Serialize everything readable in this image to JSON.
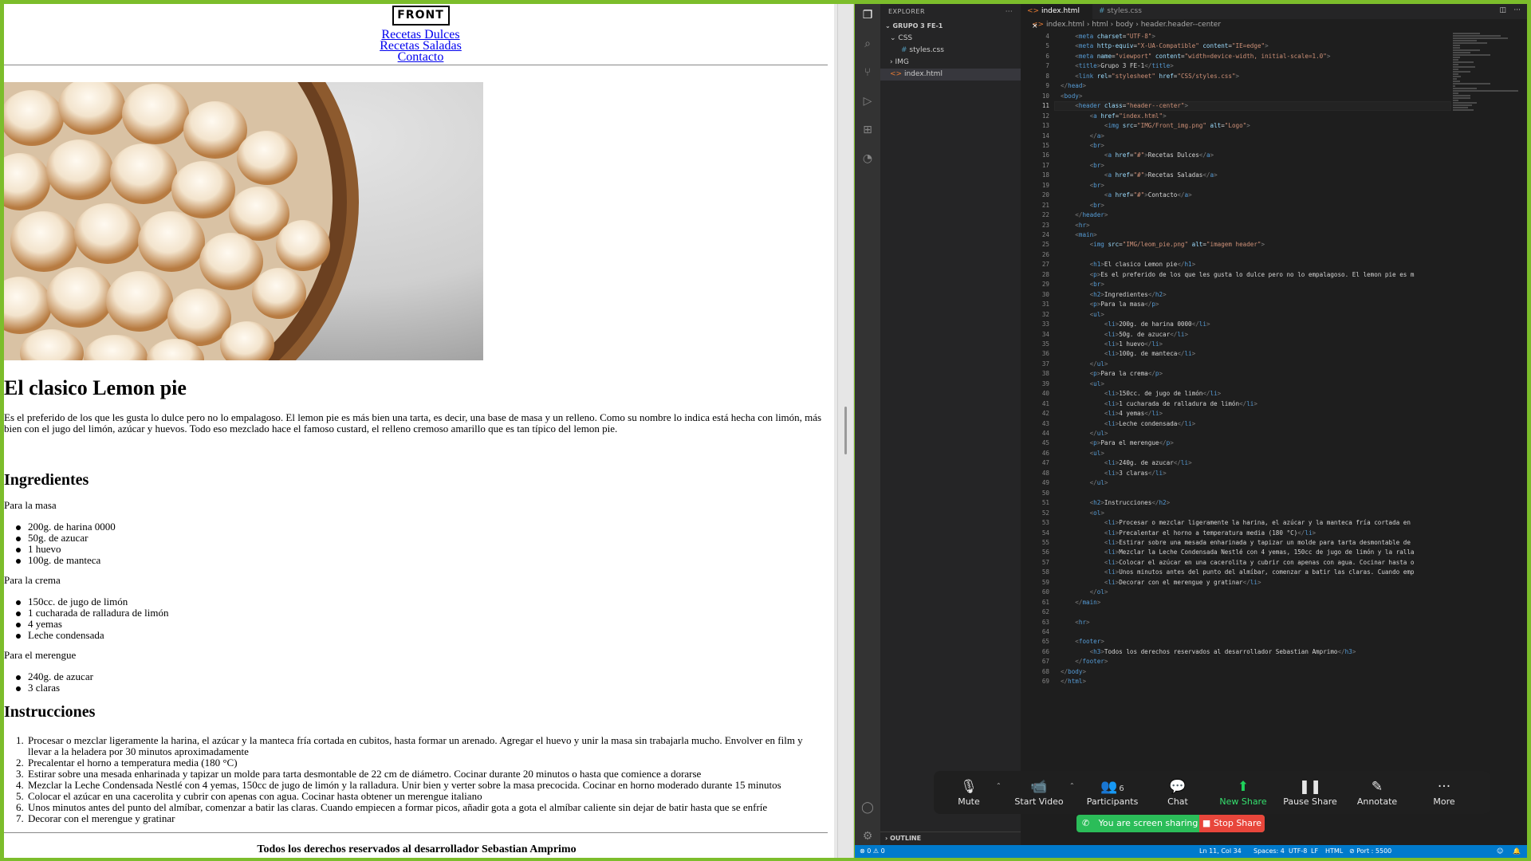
{
  "site": {
    "logo_text": "FRONT",
    "nav": [
      "Recetas Dulces",
      "Recetas Saladas",
      "Contacto"
    ],
    "title": "El clasico Lemon pie",
    "intro": "Es el preferido de los que les gusta lo dulce pero no lo empalagoso. El lemon pie es más bien una tarta, es decir, una base de masa y un relleno. Como su nombre lo indica está hecha con limón, más bien con el jugo del limón, azúcar y huevos. Todo eso mezclado hace el famoso custard, el relleno cremoso amarillo que es tan típico del lemon pie.",
    "ingredients_heading": "Ingredientes",
    "masa_label": "Para la masa",
    "masa_items": [
      "200g. de harina 0000",
      "50g. de azucar",
      "1 huevo",
      "100g. de manteca"
    ],
    "crema_label": "Para la crema",
    "crema_items": [
      "150cc. de jugo de limón",
      "1 cucharada de ralladura de limón",
      "4 yemas",
      "Leche condensada"
    ],
    "merengue_label": "Para el merengue",
    "merengue_items": [
      "240g. de azucar",
      "3 claras"
    ],
    "instructions_heading": "Instrucciones",
    "instructions": [
      "Procesar o mezclar ligeramente la harina, el azúcar y la manteca fría cortada en cubitos, hasta formar un arenado. Agregar el huevo y unir la masa sin trabajarla mucho. Envolver en film y llevar a la heladera por 30 minutos aproximadamente",
      "Precalentar el horno a temperatura media (180 °C)",
      "Estirar sobre una mesada enharinada y tapizar un molde para tarta desmontable de 22 cm de diámetro. Cocinar durante 20 minutos o hasta que comience a dorarse",
      "Mezclar la Leche Condensada Nestlé con 4 yemas, 150cc de jugo de limón y la ralladura. Unir bien y verter sobre la masa precocida. Cocinar en horno moderado durante 15 minutos",
      "Colocar el azúcar en una cacerolita y cubrir con apenas con agua. Cocinar hasta obtener un merengue italiano",
      "Unos minutos antes del punto del almíbar, comenzar a batir las claras. Cuando empiecen a formar picos, añadir gota a gota el almíbar caliente sin dejar de batir hasta que se enfríe",
      "Decorar con el merengue y gratinar"
    ],
    "footer": "Todos los derechos reservados al desarrollador Sebastian Amprimo"
  },
  "vscode": {
    "explorer_title": "EXPLORER",
    "more_glyph": "···",
    "workspace": "GRUPO 3 FE-1",
    "tree": [
      {
        "name": "CSS",
        "kind": "folder-open"
      },
      {
        "name": "styles.css",
        "kind": "css"
      },
      {
        "name": "IMG",
        "kind": "folder"
      },
      {
        "name": "index.html",
        "kind": "html"
      }
    ],
    "outline": "OUTLINE",
    "tabs": [
      {
        "label": "index.html",
        "active": true
      },
      {
        "label": "styles.css",
        "active": false
      }
    ],
    "breadcrumb": [
      "index.html",
      "html",
      "body",
      "header.header--center"
    ],
    "current_line": 11,
    "status": {
      "problems": "⊗ 0 ⚠ 0",
      "position": "Ln 11, Col 34",
      "spaces": "Spaces: 4",
      "encoding": "UTF-8",
      "eol": "LF",
      "language": "HTML",
      "port": "⊘ Port : 5500"
    }
  },
  "code": [
    [
      4,
      "    <meta charset=\"UTF-8\">"
    ],
    [
      5,
      "    <meta http-equiv=\"X-UA-Compatible\" content=\"IE=edge\">"
    ],
    [
      6,
      "    <meta name=\"viewport\" content=\"width=device-width, initial-scale=1.0\">"
    ],
    [
      7,
      "    <title>Grupo 3 FE-1</title>"
    ],
    [
      8,
      "    <link rel=\"stylesheet\" href=\"CSS/styles.css\">"
    ],
    [
      9,
      "</head>"
    ],
    [
      10,
      "<body>"
    ],
    [
      11,
      "    <header class=\"header--center\">"
    ],
    [
      12,
      "        <a href=\"index.html\">"
    ],
    [
      13,
      "            <img src=\"IMG/Front_img.png\" alt=\"Logo\">"
    ],
    [
      14,
      "        </a>"
    ],
    [
      15,
      "        <br>"
    ],
    [
      16,
      "            <a href=\"#\">Recetas Dulces</a>"
    ],
    [
      17,
      "        <br>"
    ],
    [
      18,
      "            <a href=\"#\">Recetas Saladas</a>"
    ],
    [
      19,
      "        <br>"
    ],
    [
      20,
      "            <a href=\"#\">Contacto</a>"
    ],
    [
      21,
      "        <br>"
    ],
    [
      22,
      "    </header>"
    ],
    [
      23,
      "    <hr>"
    ],
    [
      24,
      "    <main>"
    ],
    [
      25,
      "        <img src=\"IMG/leom_pie.png\" alt=\"imagem header\">"
    ],
    [
      26,
      ""
    ],
    [
      27,
      "        <h1>El clasico Lemon pie</h1>"
    ],
    [
      28,
      "        <p>Es el preferido de los que les gusta lo dulce pero no lo empalagoso. El lemon pie es m"
    ],
    [
      29,
      "        <br>"
    ],
    [
      30,
      "        <h2>Ingredientes</h2>"
    ],
    [
      31,
      "        <p>Para la masa</p>"
    ],
    [
      32,
      "        <ul>"
    ],
    [
      33,
      "            <li>200g. de harina 0000</li>"
    ],
    [
      34,
      "            <li>50g. de azucar</li>"
    ],
    [
      35,
      "            <li>1 huevo</li>"
    ],
    [
      36,
      "            <li>100g. de manteca</li>"
    ],
    [
      37,
      "        </ul>"
    ],
    [
      38,
      "        <p>Para la crema</p>"
    ],
    [
      39,
      "        <ul>"
    ],
    [
      40,
      "            <li>150cc. de jugo de limón</li>"
    ],
    [
      41,
      "            <li>1 cucharada de ralladura de limón</li>"
    ],
    [
      42,
      "            <li>4 yemas</li>"
    ],
    [
      43,
      "            <li>Leche condensada</li>"
    ],
    [
      44,
      "        </ul>"
    ],
    [
      45,
      "        <p>Para el merengue</p>"
    ],
    [
      46,
      "        <ul>"
    ],
    [
      47,
      "            <li>240g. de azucar</li>"
    ],
    [
      48,
      "            <li>3 claras</li>"
    ],
    [
      49,
      "        </ul>"
    ],
    [
      50,
      ""
    ],
    [
      51,
      "        <h2>Instrucciones</h2>"
    ],
    [
      52,
      "        <ol>"
    ],
    [
      53,
      "            <li>Procesar o mezclar ligeramente la harina, el azúcar y la manteca fría cortada en"
    ],
    [
      54,
      "            <li>Precalentar el horno a temperatura media (180 °C)</li>"
    ],
    [
      55,
      "            <li>Estirar sobre una mesada enharinada y tapizar un molde para tarta desmontable de"
    ],
    [
      56,
      "            <li>Mezclar la Leche Condensada Nestlé con 4 yemas, 150cc de jugo de limón y la ralla"
    ],
    [
      57,
      "            <li>Colocar el azúcar en una cacerolita y cubrir con apenas con agua. Cocinar hasta o"
    ],
    [
      58,
      "            <li>Unos minutos antes del punto del almíbar, comenzar a batir las claras. Cuando emp"
    ],
    [
      59,
      "            <li>Decorar con el merengue y gratinar</li>"
    ],
    [
      60,
      "        </ol>"
    ],
    [
      61,
      "    </main>"
    ],
    [
      62,
      ""
    ],
    [
      63,
      "    <hr>"
    ],
    [
      64,
      ""
    ],
    [
      65,
      "    <footer>"
    ],
    [
      66,
      "        <h3>Todos los derechos reservados al desarrollador Sebastian Amprimo</h3>"
    ],
    [
      67,
      "    </footer>"
    ],
    [
      68,
      "</body>"
    ],
    [
      69,
      "</html>"
    ]
  ],
  "zoom": {
    "buttons": [
      {
        "label": "Mute",
        "icon": "microphone-icon",
        "glyph": "🎙"
      },
      {
        "label": "Start Video",
        "icon": "video-off-icon",
        "glyph": "📹"
      },
      {
        "label": "Participants",
        "icon": "participants-icon",
        "glyph": "👥",
        "badge": "6"
      },
      {
        "label": "Chat",
        "icon": "chat-icon",
        "glyph": "💬"
      },
      {
        "label": "New Share",
        "icon": "share-arrow-icon",
        "glyph": "⬆"
      },
      {
        "label": "Pause Share",
        "icon": "pause-icon",
        "glyph": "❚❚"
      },
      {
        "label": "Annotate",
        "icon": "pen-icon",
        "glyph": "✎"
      },
      {
        "label": "More",
        "icon": "more-icon",
        "glyph": "···"
      }
    ],
    "sharing_text": "You are screen sharing",
    "stop_label": "Stop Share",
    "accent_green": "#2bbd59",
    "stop_red": "#e8463b"
  },
  "colors": {
    "share_border": "#7cbd2b",
    "vscode_status": "#007acc",
    "link": "#0000ee"
  }
}
